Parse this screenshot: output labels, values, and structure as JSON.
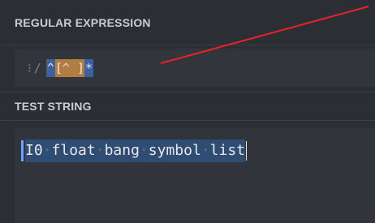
{
  "regex_section": {
    "label": "REGULAR EXPRESSION",
    "flags_icon": "vertical-dots-icon",
    "delimiter": "/",
    "tokens": {
      "anchor": "^",
      "class_open": "[",
      "class_inner": "^ ",
      "class_close": "]",
      "quantifier": "*"
    }
  },
  "test_section": {
    "label": "TEST STRING",
    "words": [
      "I0",
      "float",
      "bang",
      "symbol",
      "list"
    ],
    "whitespace_marker": "·"
  },
  "colors": {
    "background": "#2b2e33",
    "input_bg": "#32363c",
    "anchor_highlight": "#3f5f9e",
    "class_highlight": "#b07d42",
    "annotation_line": "#e3232a",
    "match_bar": "#6fa0ff"
  }
}
